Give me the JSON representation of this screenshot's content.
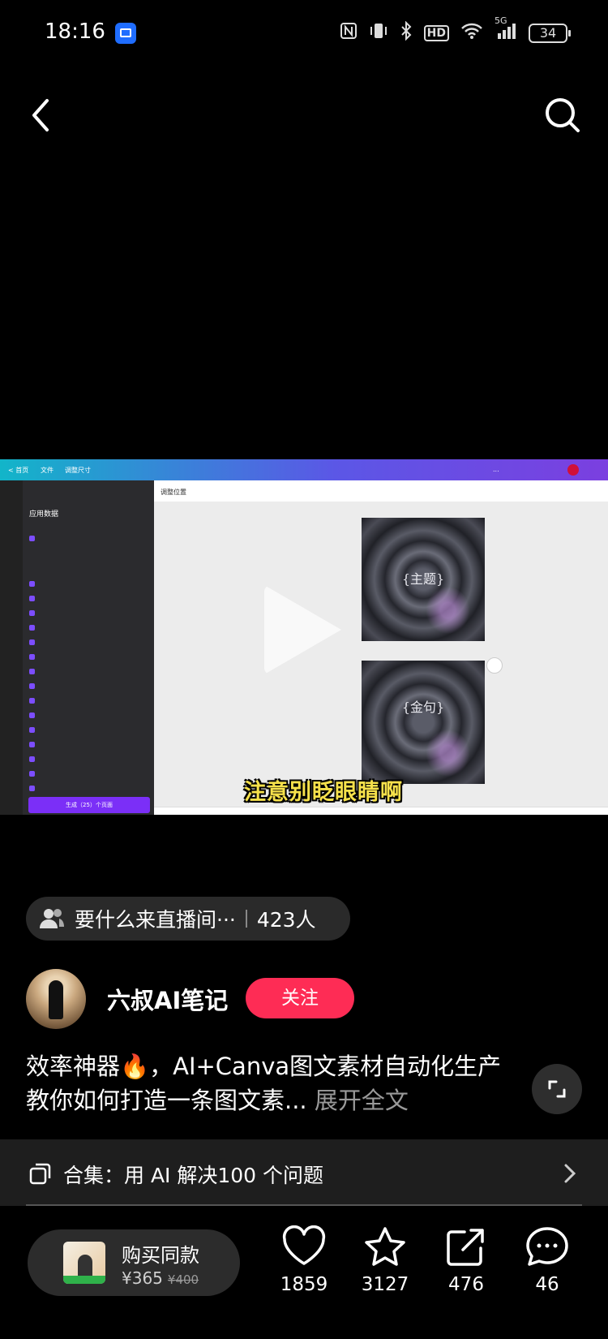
{
  "status_bar": {
    "time": "18:16",
    "icons": [
      "nfc-icon",
      "vibrate-icon",
      "bluetooth-icon",
      "hd-icon",
      "wifi-icon",
      "5g-signal-icon"
    ],
    "signal_label": "5G",
    "hd_label": "HD",
    "battery": "34"
  },
  "video": {
    "subtitle": "注意别眨眼睛啊",
    "canvas_title": "调整位置",
    "panel_heading": "应用数据",
    "cta_label": "生成（25）个页面",
    "page1_text": "{主题}",
    "page2_text": "{金句}"
  },
  "live": {
    "text": "要什么来直播间···",
    "count": "423人"
  },
  "author": {
    "name": "六叔AI笔记",
    "follow_label": "关注"
  },
  "description": {
    "text": "效率神器🔥，AI+Canva图文素材自动化生产 教你如何打造一条图文素...",
    "more_label": "展开全文"
  },
  "collection": {
    "label": "合集：用 AI 解决100 个问题"
  },
  "buy": {
    "label": "购买同款",
    "price": "¥365",
    "original_price": "¥400"
  },
  "actions": {
    "likes": "1859",
    "favorites": "3127",
    "shares": "476",
    "comments": "46"
  },
  "colors": {
    "follow": "#fe2c55",
    "background": "#000000",
    "subtitle": "#f6e14b"
  }
}
